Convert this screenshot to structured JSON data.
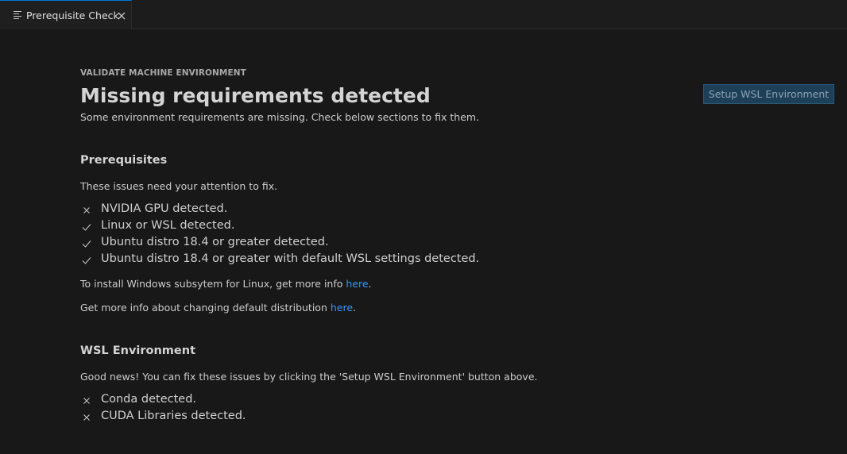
{
  "tab": {
    "label": "Prerequisite Check",
    "icon": "preview-lines-icon",
    "close_icon": "close-icon"
  },
  "header": {
    "eyebrow": "VALIDATE MACHINE ENVIRONMENT",
    "title": "Missing requirements detected",
    "subtitle": "Some environment requirements are missing. Check below sections to fix them.",
    "setup_button": "Setup WSL Environment"
  },
  "prerequisites": {
    "title": "Prerequisites",
    "description": "These issues need your attention to fix.",
    "items": [
      {
        "status": "fail",
        "label": "NVIDIA GPU detected."
      },
      {
        "status": "pass",
        "label": "Linux or WSL detected."
      },
      {
        "status": "pass",
        "label": "Ubuntu distro 18.4 or greater detected."
      },
      {
        "status": "pass",
        "label": "Ubuntu distro 18.4 or greater with default WSL settings detected."
      }
    ],
    "info_wsl": {
      "text": "To install Windows subsytem for Linux, get more info ",
      "link": "here",
      "suffix": "."
    },
    "info_distro": {
      "text": "Get more info about changing default distribution ",
      "link": "here",
      "suffix": "."
    }
  },
  "wsl_environment": {
    "title": "WSL Environment",
    "description": "Good news! You can fix these issues by clicking the 'Setup WSL Environment' button above.",
    "items": [
      {
        "status": "fail",
        "label": "Conda detected."
      },
      {
        "status": "fail",
        "label": "CUDA Libraries detected."
      }
    ]
  },
  "colors": {
    "background": "#181818",
    "accent_link": "#3794ff",
    "button_bg": "#1d3f57"
  }
}
